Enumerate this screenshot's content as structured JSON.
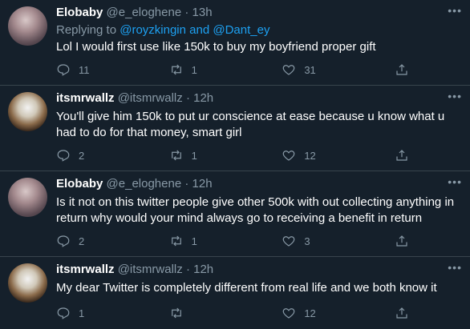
{
  "tweets": [
    {
      "name": "Elobaby",
      "handle": "@e_eloghene",
      "time": "13h",
      "reply_prefix": "Replying to ",
      "reply_user1": "@royzkingin",
      "reply_and": " and ",
      "reply_user2": "@Dant_ey",
      "text": "Lol I would first use like 150k to buy my boyfriend proper gift",
      "replies": "11",
      "retweets": "1",
      "likes": "31"
    },
    {
      "name": "itsmrwallz",
      "handle": "@itsmrwallz",
      "time": "12h",
      "text": "You'll give him 150k to put ur conscience at ease because u know what u had to do for that money, smart girl",
      "replies": "2",
      "retweets": "1",
      "likes": "12"
    },
    {
      "name": "Elobaby",
      "handle": "@e_eloghene",
      "time": "12h",
      "text": "Is it not on this twitter people give other 500k with out collecting anything in return why would your mind always go to receiving a benefit in return",
      "replies": "2",
      "retweets": "1",
      "likes": "3"
    },
    {
      "name": "itsmrwallz",
      "handle": "@itsmrwallz",
      "time": "12h",
      "text": "My dear Twitter is completely different from real life and we both know it",
      "replies": "1",
      "retweets": "",
      "likes": "12"
    }
  ],
  "ui": {
    "dot": "·",
    "more": "•••"
  },
  "colors": {
    "background": "#15202b",
    "secondary_text": "#8899a6",
    "link": "#1da1f2",
    "divider": "#38444d"
  },
  "icons": [
    "reply-icon",
    "retweet-icon",
    "like-icon",
    "share-icon",
    "more-icon"
  ]
}
